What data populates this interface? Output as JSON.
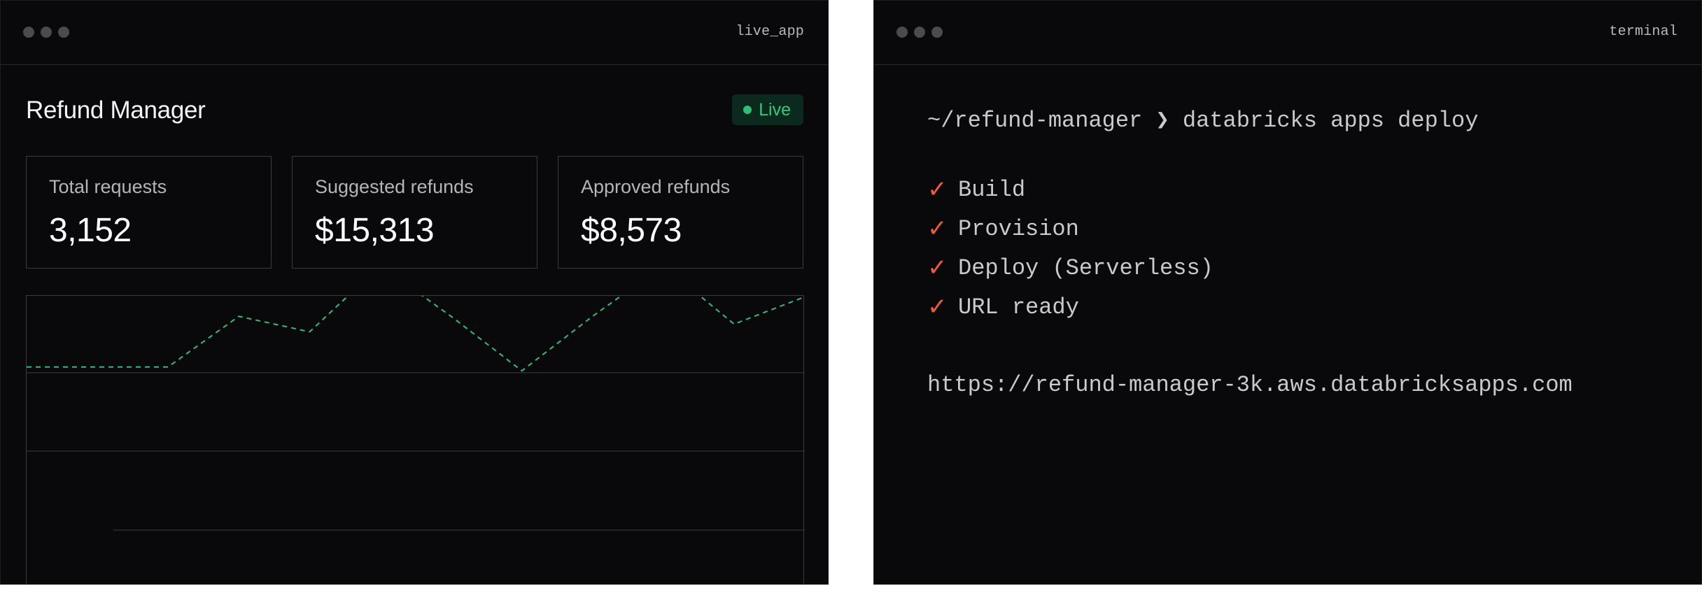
{
  "live_app": {
    "window_title": "live_app",
    "title": "Refund Manager",
    "badge": "Live",
    "stats": [
      {
        "label": "Total requests",
        "value": "3,152"
      },
      {
        "label": "Suggested refunds",
        "value": "$15,313"
      },
      {
        "label": "Approved refunds",
        "value": "$8,573"
      }
    ]
  },
  "chart_data": {
    "type": "line",
    "series": [
      {
        "values": [
          62,
          62,
          62,
          75,
          71,
          88,
          75,
          61,
          75,
          88,
          73,
          80
        ]
      }
    ],
    "ylim": [
      0,
      100
    ],
    "grid": true,
    "line_color": "#2fbf73",
    "line_style": "dashed"
  },
  "terminal": {
    "window_title": "terminal",
    "prompt": "~/refund-manager",
    "prompt_symbol": "❯",
    "command": "databricks apps deploy",
    "check_glyph": "✓",
    "steps": [
      "Build",
      "Provision",
      "Deploy (Serverless)",
      "URL ready"
    ],
    "url": "https://refund-manager-3k.aws.databricksapps.com"
  },
  "colors": {
    "background": "#09090b",
    "accent_green": "#2fbf73",
    "check_red": "#f05a38",
    "text_muted": "#b4b4ba"
  }
}
